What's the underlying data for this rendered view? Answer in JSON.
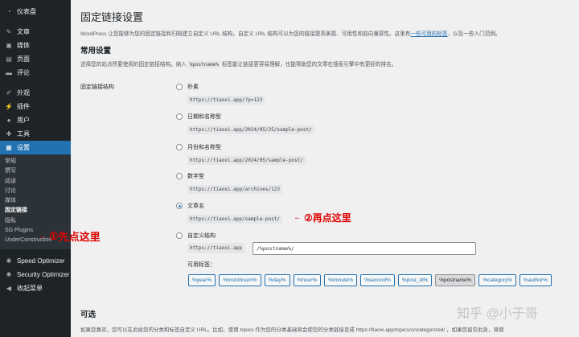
{
  "sidebar": {
    "items_top": [
      {
        "label": "仪表盘",
        "icon": "dashboard-icon",
        "glyph": "◔"
      }
    ],
    "items_mid": [
      {
        "label": "文章",
        "icon": "posts-icon",
        "glyph": "✎"
      },
      {
        "label": "媒体",
        "icon": "media-icon",
        "glyph": "▣"
      },
      {
        "label": "页面",
        "icon": "pages-icon",
        "glyph": "▤"
      },
      {
        "label": "评论",
        "icon": "comments-icon",
        "glyph": "▬"
      }
    ],
    "items_low": [
      {
        "label": "外观",
        "icon": "appearance-icon",
        "glyph": "✐"
      },
      {
        "label": "插件",
        "icon": "plugins-icon",
        "glyph": "⚡"
      },
      {
        "label": "用户",
        "icon": "users-icon",
        "glyph": "●"
      },
      {
        "label": "工具",
        "icon": "tools-icon",
        "glyph": "✚"
      },
      {
        "label": "设置",
        "icon": "settings-icon",
        "glyph": "▦"
      }
    ],
    "submenu": [
      "常规",
      "撰写",
      "阅读",
      "讨论",
      "媒体",
      "固定链接",
      "隐私",
      "SG Plugins",
      "UnderConstruction"
    ],
    "items_bottom": [
      {
        "label": "Speed Optimizer",
        "icon": "speed-optimizer-icon",
        "glyph": "✺"
      },
      {
        "label": "Security Optimizer",
        "icon": "security-optimizer-icon",
        "glyph": "✺"
      },
      {
        "label": "收起菜单",
        "icon": "collapse-menu-icon",
        "glyph": "◀"
      }
    ]
  },
  "page": {
    "title": "固定链接设置",
    "intro_before": "WordPress 让您能够为您的固定链接和归档建立自定义 URL 结构。自定义 URL 结构可以为您的链接提高美感、可用性和前向兼容性。这里有",
    "intro_link": "一些可用的标签",
    "intro_after": "，以及一些入门范例。",
    "common_heading": "常用设置",
    "common_desc_before": "选择您的站点所要使用的固定链接结构。纳入",
    "common_desc_code": "%postname%",
    "common_desc_after": "标签能让链接更容易理解，也能帮助您的文章在搜索引擎中有更好的排名。",
    "structure_label": "固定链接结构",
    "options": [
      {
        "label": "朴素",
        "example": "https://tiaoxi.app/?p=123",
        "checked": false
      },
      {
        "label": "日期和名称型",
        "example": "https://tiaoxi.app/2024/05/25/sample-post/",
        "checked": false
      },
      {
        "label": "月份和名称型",
        "example": "https://tiaoxi.app/2024/05/sample-post/",
        "checked": false
      },
      {
        "label": "数字型",
        "example": "https://tiaoxi.app/archives/123",
        "checked": false
      },
      {
        "label": "文章名",
        "example": "https://tiaoxi.app/sample-post/",
        "checked": true
      },
      {
        "label": "自定义结构",
        "example": "",
        "checked": false
      }
    ],
    "custom_prefix": "https://tiaoxi.app",
    "custom_value": "/%postname%/",
    "tags_label": "可用标签：",
    "tags": [
      "%year%",
      "%monthnum%",
      "%day%",
      "%hour%",
      "%minute%",
      "%second%",
      "%post_id%",
      "%postname%",
      "%category%",
      "%author%"
    ],
    "selected_tag": "%postname%",
    "optional_heading": "可选",
    "footer_text": "如果您喜欢，您可以在此给您的分类和标签自定义 URL。比如，使用 topics 作为您的分类基础将会使您的分类链接变成 https://tiaoxi.app/topics/uncategorized/ ，如果您留空此处，将使"
  },
  "annotations": {
    "first": {
      "num": "①",
      "text": "先点这里"
    },
    "second": {
      "num": "②",
      "text": "再点这里"
    },
    "watermark": "知乎 @小于哥"
  },
  "colors": {
    "sidebar_bg": "#1d2327",
    "active": "#2271b1",
    "annotation": "#e00000"
  }
}
